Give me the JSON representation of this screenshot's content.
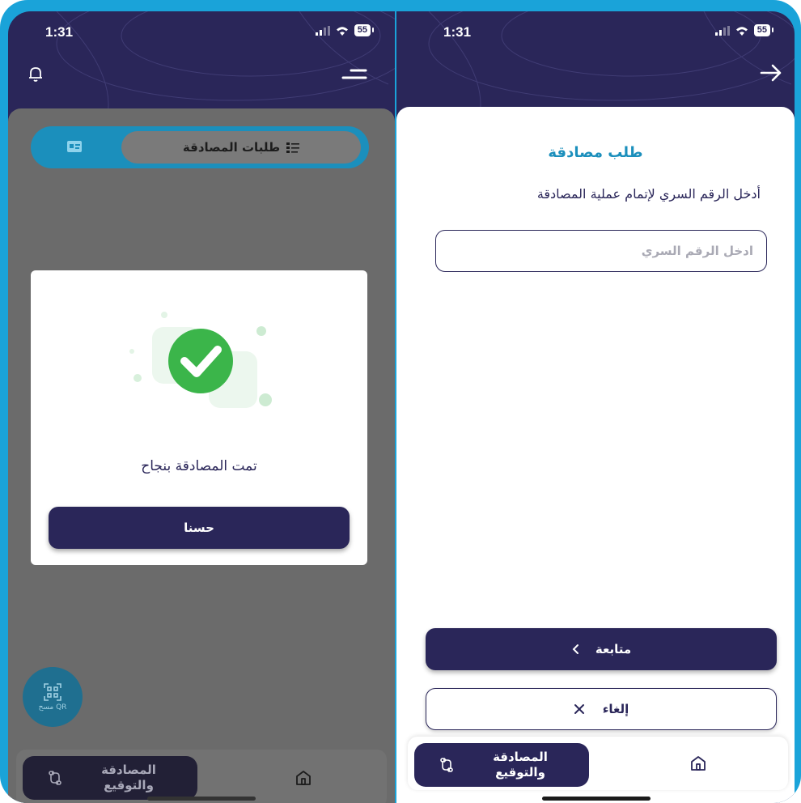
{
  "status": {
    "time": "1:31",
    "battery": "55"
  },
  "left": {
    "tabs": {
      "requests_label": "طلبات المصادقة"
    },
    "modal": {
      "message": "تمت المصادقة بنجاح",
      "ok_label": "حسنا"
    },
    "qr_fab": {
      "label": "مسح QR"
    }
  },
  "right": {
    "title": "طلب مصادقة",
    "subtitle": "أدخل الرقم السري لإتمام عملية المصادقة",
    "pin": {
      "placeholder": "ادخل الرقم السري",
      "value": ""
    },
    "continue_label": "متابعة",
    "cancel_label": "إلغاء"
  },
  "tabbar": {
    "auth_label": "المصادقة والتوقيع"
  },
  "colors": {
    "primary": "#2a2659",
    "accent": "#1b8fbc",
    "success": "#3bb54a",
    "frame": "#1aa3d9"
  },
  "icons": [
    "bell-icon",
    "menu-icon",
    "list-icon",
    "id-card-icon",
    "check-icon",
    "qr-icon",
    "sign-icon",
    "home-icon",
    "arrow-right-icon",
    "chevron-left-icon",
    "close-icon"
  ]
}
